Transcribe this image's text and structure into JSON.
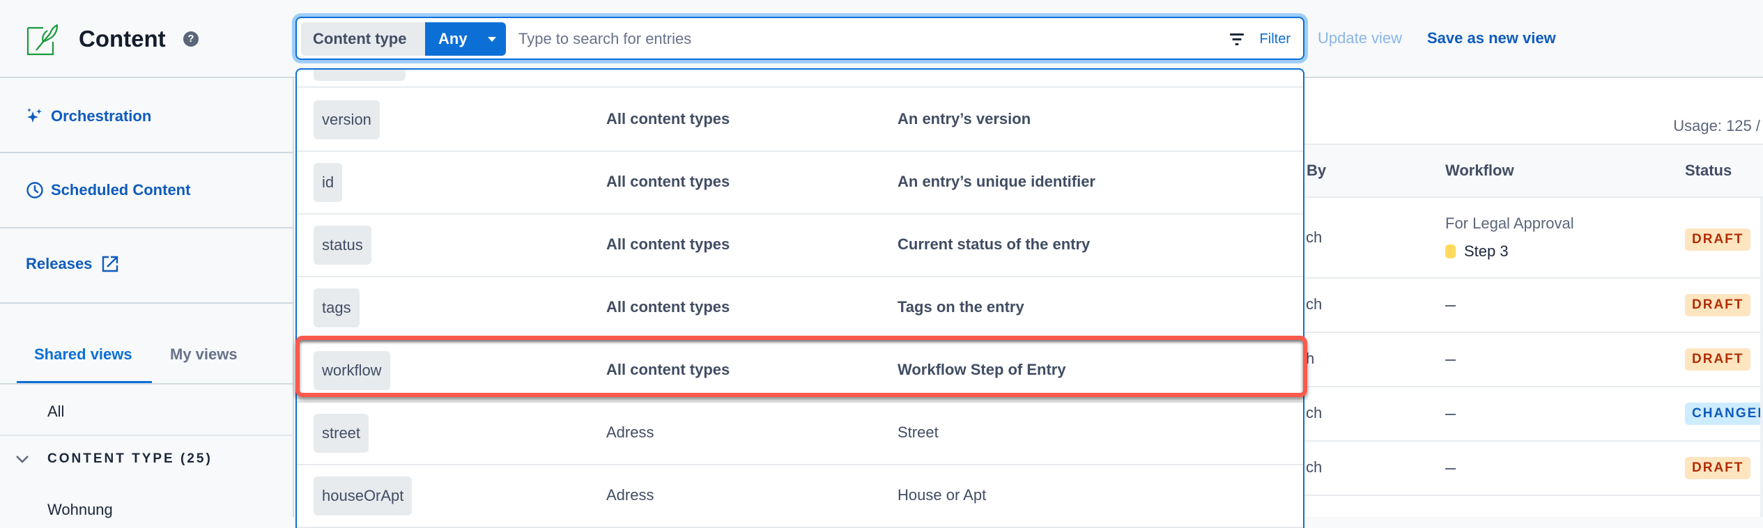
{
  "header": {
    "title": "Content",
    "help_icon": "?",
    "update_view_label": "Update view",
    "save_view_label": "Save as new view"
  },
  "search": {
    "content_type_label": "Content type",
    "content_type_value": "Any",
    "placeholder": "Type to search for entries",
    "value": "",
    "filter_label": "Filter"
  },
  "sidebar": {
    "links": [
      {
        "label": "Orchestration",
        "icon": "sparkles-icon"
      },
      {
        "label": "Scheduled Content",
        "icon": "clock-icon"
      },
      {
        "label": "Releases",
        "icon": "external-link-icon"
      }
    ],
    "tabs": [
      {
        "label": "Shared views",
        "active": true
      },
      {
        "label": "My views",
        "active": false
      }
    ],
    "views": [
      "All"
    ],
    "group_label": "CONTENT TYPE (25)",
    "group_items": [
      "Wohnung"
    ]
  },
  "dropdown": {
    "rows": [
      {
        "field": "version",
        "content_type": "All content types",
        "description": "An entry’s version",
        "bold": true
      },
      {
        "field": "id",
        "content_type": "All content types",
        "description": "An entry’s unique identifier",
        "bold": true
      },
      {
        "field": "status",
        "content_type": "All content types",
        "description": "Current status of the entry",
        "bold": true
      },
      {
        "field": "tags",
        "content_type": "All content types",
        "description": "Tags on the entry",
        "bold": true
      },
      {
        "field": "workflow",
        "content_type": "All content types",
        "description": "Workflow Step of Entry",
        "bold": true,
        "highlighted": true
      },
      {
        "field": "street",
        "content_type": "Adress",
        "description": "Street",
        "bold": false
      },
      {
        "field": "houseOrApt",
        "content_type": "Adress",
        "description": "House or Apt",
        "bold": false
      }
    ]
  },
  "table": {
    "usage": "Usage: 125 /",
    "columns": [
      "By",
      "Workflow",
      "Status"
    ],
    "rows": [
      {
        "by": "ch",
        "workflow_name": "For Legal Approval",
        "workflow_step": "Step 3",
        "status": "DRAFT"
      },
      {
        "by": "ch",
        "workflow": "—",
        "status": "DRAFT"
      },
      {
        "by": "h",
        "workflow": "—",
        "status": "DRAFT"
      },
      {
        "by": "ch",
        "workflow": "—",
        "status": "CHANGED"
      },
      {
        "by": "ch",
        "workflow": "—",
        "status": "DRAFT"
      }
    ]
  },
  "colors": {
    "accent": "#0c6fd6",
    "link": "#0e5bbd",
    "highlight": "#fa5a4c",
    "draft_bg": "#fde5c0",
    "draft_fg": "#b32c00",
    "changed_bg": "#ceecff",
    "changed_fg": "#0e5bbd",
    "step_dot": "#ffda5f"
  }
}
